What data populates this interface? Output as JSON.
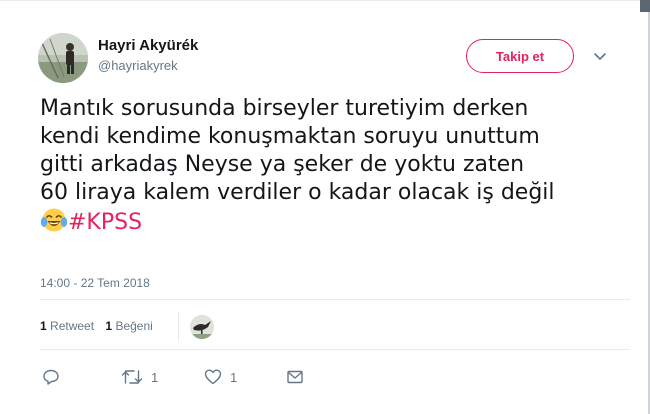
{
  "author": {
    "name": "Hayri Akyürék",
    "handle": "@hayriakyrek",
    "avatar_icon": "user-photo"
  },
  "follow_button": {
    "label": "Takip et",
    "color": "#e0245e"
  },
  "tweet": {
    "lines": [
      "Mantık sorusunda birseyler turetiyim derken",
      "kendi kendime konuşmaktan soruyu unuttum",
      "gitti arkadaş Neyse ya şeker de yoktu zaten",
      "60 liraya kalem verdiler o kadar olacak iş değil"
    ],
    "emoji_icon": "face-with-tears-of-joy",
    "hashtag": "#KPSS",
    "hashtag_color": "#e0245e"
  },
  "timestamp": "14:00 - 22 Tem 2018",
  "stats": {
    "retweet_count": "1",
    "retweet_label": "Retweet",
    "like_count": "1",
    "like_label": "Beğeni"
  },
  "actions": {
    "reply_icon": "reply-icon",
    "retweet_icon": "retweet-icon",
    "retweet_count": "1",
    "like_icon": "heart-icon",
    "like_count": "1",
    "dm_icon": "envelope-icon"
  }
}
